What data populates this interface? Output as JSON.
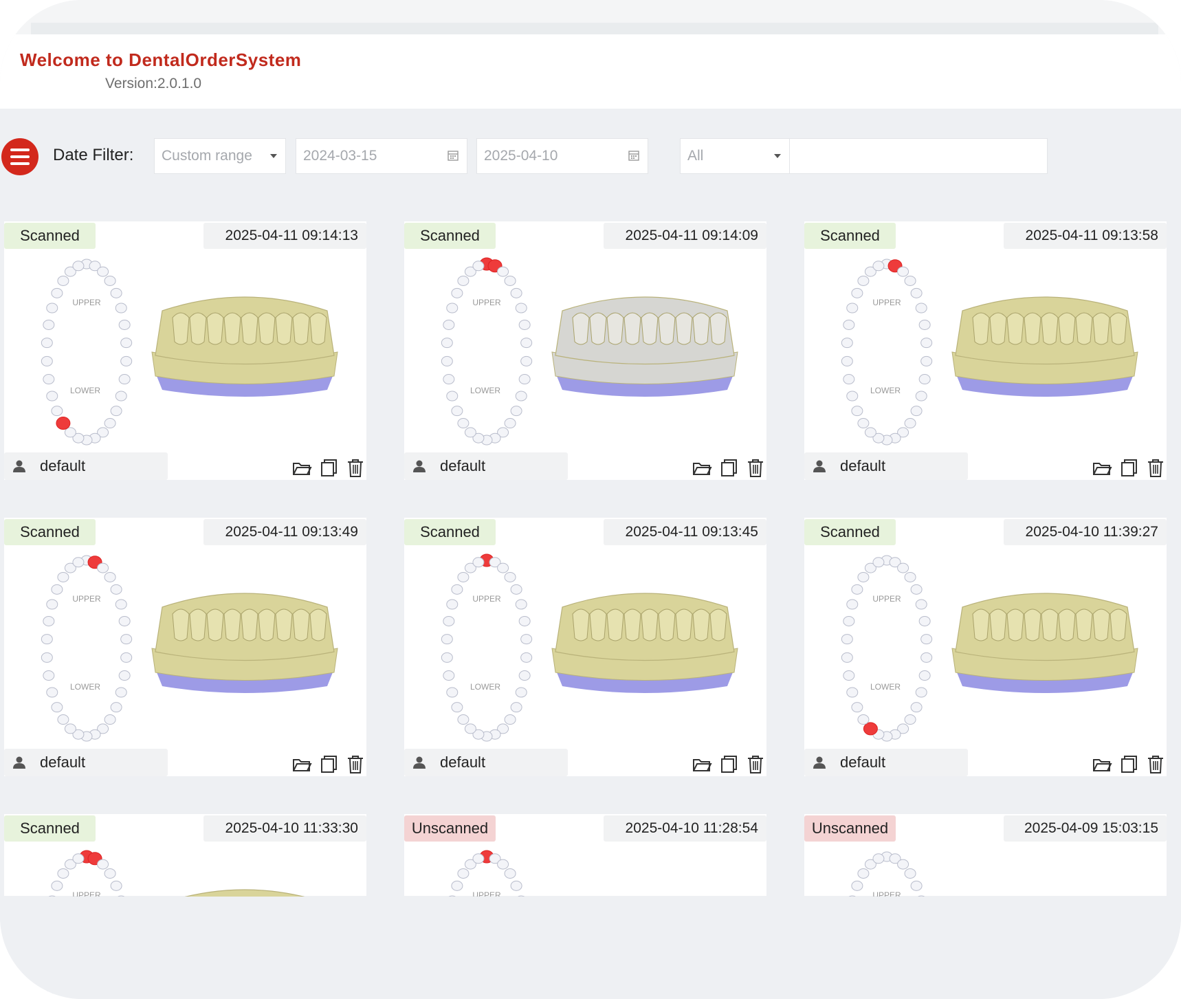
{
  "app": {
    "title": "Welcome to DentalOrderSystem",
    "version": "Version:2.0.1.0"
  },
  "filter": {
    "label": "Date Filter:",
    "range_select": "Custom range",
    "start_date": "2024-03-15",
    "end_date": "2025-04-10",
    "status_select": "All",
    "search_value": ""
  },
  "chart_labels": {
    "upper": "UPPER",
    "lower": "LOWER"
  },
  "colors": {
    "brand": "#c12a1d",
    "scanned_bg": "#e7f3dc",
    "unscanned_bg": "#f4d3d3",
    "model_gold": "#d9d49a",
    "model_base": "#9d9be6",
    "model_gray": "#d6d6d2"
  },
  "orders": [
    {
      "status": "Scanned",
      "timestamp": "2025-04-11 09:14:13",
      "user": "default"
    },
    {
      "status": "Scanned",
      "timestamp": "2025-04-11 09:14:09",
      "user": "default"
    },
    {
      "status": "Scanned",
      "timestamp": "2025-04-11 09:13:58",
      "user": "default"
    },
    {
      "status": "Scanned",
      "timestamp": "2025-04-11 09:13:49",
      "user": "default"
    },
    {
      "status": "Scanned",
      "timestamp": "2025-04-11 09:13:45",
      "user": "default"
    },
    {
      "status": "Scanned",
      "timestamp": "2025-04-10 11:39:27",
      "user": "default"
    },
    {
      "status": "Scanned",
      "timestamp": "2025-04-10 11:33:30",
      "user": ""
    },
    {
      "status": "Unscanned",
      "timestamp": "2025-04-10 11:28:54",
      "user": ""
    },
    {
      "status": "Unscanned",
      "timestamp": "2025-04-09 15:03:15",
      "user": ""
    }
  ],
  "icons": {
    "menu": "hamburger-icon",
    "calendar": "calendar-icon",
    "user": "user-icon",
    "open": "folder-open-icon",
    "copy": "copy-icon",
    "delete": "trash-icon"
  }
}
